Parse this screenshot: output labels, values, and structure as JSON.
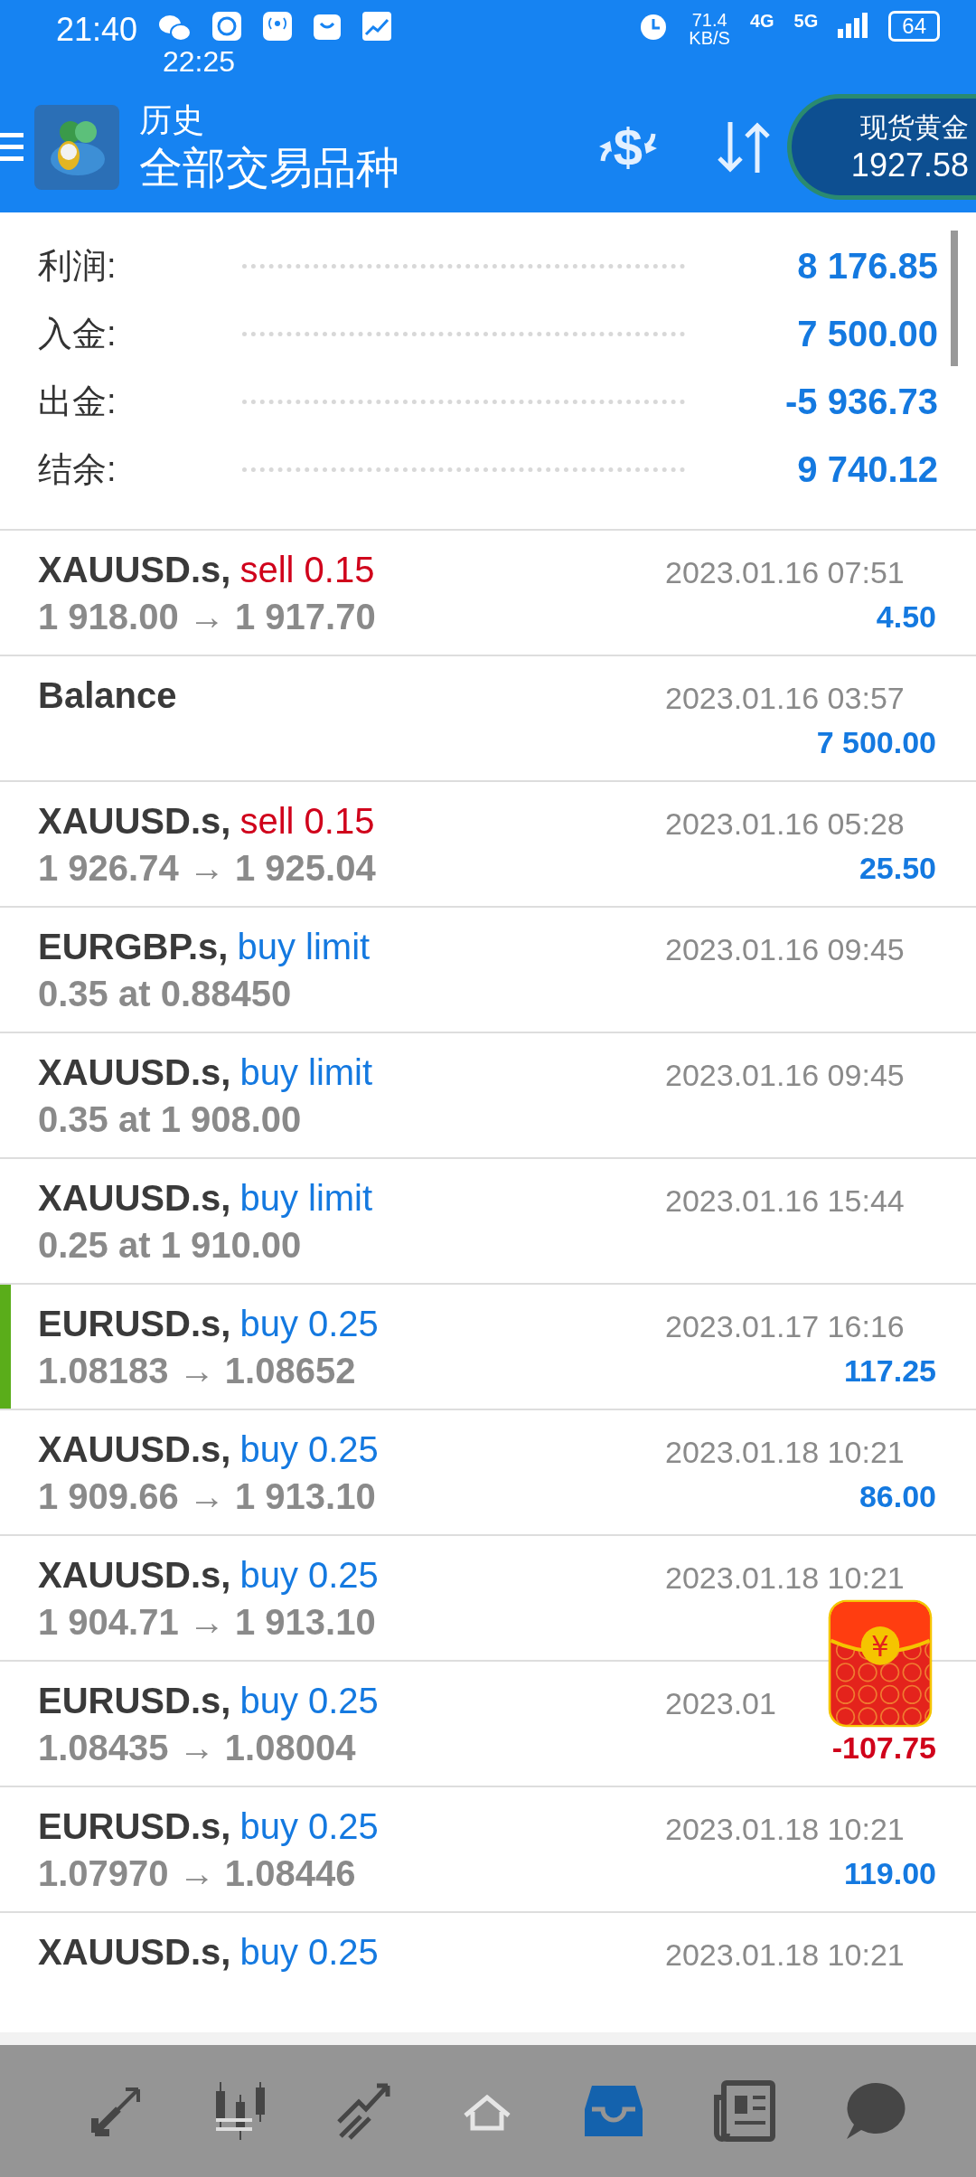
{
  "status_bar": {
    "time": "21:40",
    "overlay_time": "22:25",
    "net_speed": "71.4",
    "net_unit": "KB/S",
    "net_types": [
      "4G",
      "5G"
    ],
    "battery": "64"
  },
  "header": {
    "title": "历史",
    "subtitle": "全部交易品种",
    "exchange_symbol": "$",
    "ticker": {
      "name": "现货黄金",
      "price": "1927.58"
    }
  },
  "summary": [
    {
      "label": "利润:",
      "value": "8 176.85"
    },
    {
      "label": "入金:",
      "value": "7 500.00"
    },
    {
      "label": "出金:",
      "value": "-5 936.73"
    },
    {
      "label": "结余:",
      "value": "9 740.12"
    }
  ],
  "deals": [
    {
      "symbol": "XAUUSD.s,",
      "action": "sell 0.15",
      "sell": true,
      "prices": "1 918.00 → 1 917.70",
      "time": "2023.01.16 07:51",
      "profit": "4.50",
      "loss": false,
      "marked": false
    },
    {
      "symbol": "Balance",
      "time": "2023.01.16 03:57",
      "profit": "7 500.00",
      "loss": false,
      "marked": false
    },
    {
      "symbol": "XAUUSD.s,",
      "action": "sell 0.15",
      "sell": true,
      "prices": "1 926.74 → 1 925.04",
      "time": "2023.01.16 05:28",
      "profit": "25.50",
      "loss": false,
      "marked": false
    },
    {
      "symbol": "EURGBP.s,",
      "action": "buy limit",
      "sell": false,
      "prices": "0.35 at 0.88450",
      "time": "2023.01.16 09:45",
      "marked": false
    },
    {
      "symbol": "XAUUSD.s,",
      "action": "buy limit",
      "sell": false,
      "prices": "0.35 at 1 908.00",
      "time": "2023.01.16 09:45",
      "marked": false
    },
    {
      "symbol": "XAUUSD.s,",
      "action": "buy limit",
      "sell": false,
      "prices": "0.25 at 1 910.00",
      "time": "2023.01.16 15:44",
      "marked": false
    },
    {
      "symbol": "EURUSD.s,",
      "action": "buy 0.25",
      "sell": false,
      "prices": "1.08183 → 1.08652",
      "time": "2023.01.17 16:16",
      "profit": "117.25",
      "loss": false,
      "marked": true
    },
    {
      "symbol": "XAUUSD.s,",
      "action": "buy 0.25",
      "sell": false,
      "prices": "1 909.66 → 1 913.10",
      "time": "2023.01.18 10:21",
      "profit": "86.00",
      "loss": false,
      "marked": false
    },
    {
      "symbol": "XAUUSD.s,",
      "action": "buy 0.25",
      "sell": false,
      "prices": "1 904.71 → 1 913.10",
      "time": "2023.01.18 10:21",
      "marked": false
    },
    {
      "symbol": "EURUSD.s,",
      "action": "buy 0.25",
      "sell": false,
      "prices": "1.08435 → 1.08004",
      "time": "2023.01",
      "profit": "-107.75",
      "loss": true,
      "marked": false
    },
    {
      "symbol": "EURUSD.s,",
      "action": "buy 0.25",
      "sell": false,
      "prices": "1.07970 → 1.08446",
      "time": "2023.01.18 10:21",
      "profit": "119.00",
      "loss": false,
      "marked": false
    },
    {
      "symbol": "XAUUSD.s,",
      "action": "buy 0.25",
      "sell": false,
      "time": "2023.01.18 10:21",
      "marked": false
    }
  ],
  "red_packet": {
    "symbol": "¥"
  },
  "bottom_nav": [
    {
      "kind": "quotes",
      "selected": false
    },
    {
      "kind": "charts",
      "selected": false
    },
    {
      "kind": "trade",
      "selected": false
    },
    {
      "kind": "home",
      "selected": false
    },
    {
      "kind": "history",
      "selected": true
    },
    {
      "kind": "news",
      "selected": false
    },
    {
      "kind": "chat",
      "selected": false
    }
  ]
}
